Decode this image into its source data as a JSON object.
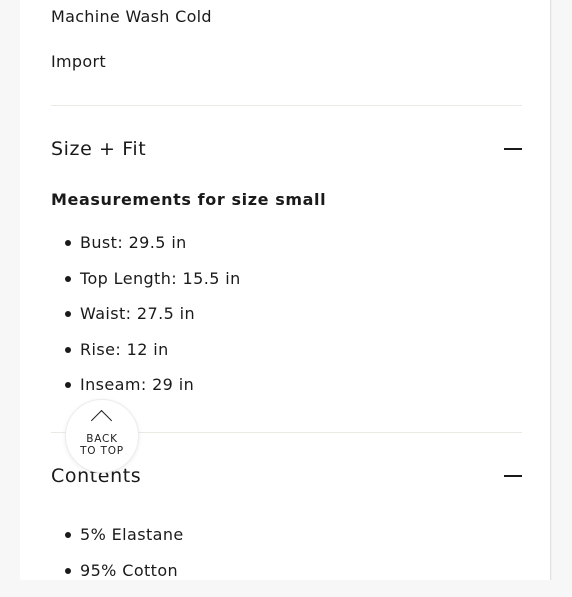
{
  "care": {
    "wash": "Machine Wash Cold",
    "origin": "Import"
  },
  "size_fit": {
    "title": "Size + Fit",
    "collapse_icon": "minus-icon",
    "subheading": "Measurements for size small",
    "items": [
      "Bust: 29.5 in",
      "Top Length: 15.5 in",
      "Waist: 27.5 in",
      "Rise: 12 in",
      "Inseam: 29 in"
    ]
  },
  "contents": {
    "title": "Contents",
    "collapse_icon": "minus-icon",
    "items": [
      "5% Elastane",
      "95% Cotton"
    ]
  },
  "back_to_top": {
    "icon": "chevron-up-icon",
    "line1": "BACK",
    "line2": "TO TOP"
  }
}
